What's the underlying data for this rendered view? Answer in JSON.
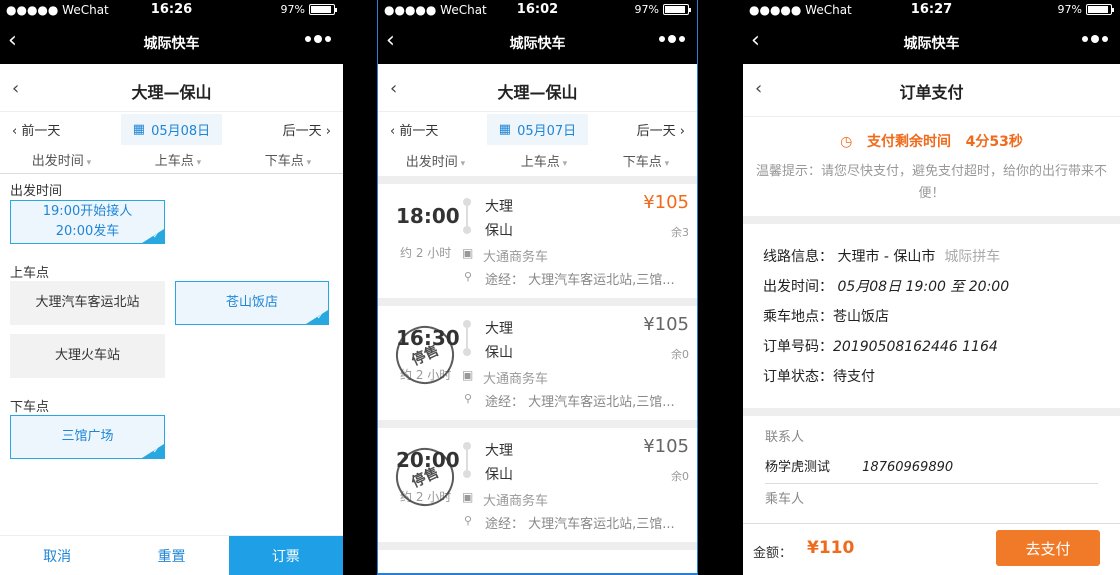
{
  "screens": [
    {
      "status": {
        "carrier": "●●●●● WeChat",
        "time": "16:26",
        "battery": "97%"
      },
      "nav_title": "城际快车",
      "page_title": "大理—保山",
      "prev_day": "前一天",
      "date": "05月08日",
      "next_day": "后一天",
      "filters": [
        "出发时间",
        "上车点",
        "下车点"
      ],
      "departure_label": "出发时间",
      "departure_option_line1": "19:00开始接人",
      "departure_option_line2": "20:00发车",
      "boarding_label": "上车点",
      "boarding_options": [
        "大理汽车客运北站",
        "苍山饭店",
        "大理火车站"
      ],
      "dropoff_label": "下车点",
      "dropoff_option": "三馆广场",
      "cancel": "取消",
      "reset": "重置",
      "book": "订票"
    },
    {
      "status": {
        "carrier": "●●●●● WeChat",
        "time": "16:02",
        "battery": "97%"
      },
      "nav_title": "城际快车",
      "page_title": "大理—保山",
      "prev_day": "前一天",
      "date": "05月07日",
      "next_day": "后一天",
      "filters": [
        "出发时间",
        "上车点",
        "下车点"
      ],
      "trips": [
        {
          "time": "18:00",
          "duration": "约 2 小时",
          "from": "大理",
          "to": "保山",
          "price": "¥105",
          "seats": "余3",
          "vehicle": "大通商务车",
          "via": "途经：  大理汽车客运北站,三馆..."
        },
        {
          "time": "16:30",
          "duration": "约 2 小时",
          "from": "大理",
          "to": "保山",
          "price": "¥105",
          "seats": "余0",
          "vehicle": "大通商务车",
          "via": "途经：  大理汽车客运北站,三馆...",
          "stamp": "停售"
        },
        {
          "time": "20:00",
          "duration": "约 2 小时",
          "from": "大理",
          "to": "保山",
          "price": "¥105",
          "seats": "余0",
          "vehicle": "大通商务车",
          "via": "途经：  大理汽车客运北站,三馆...",
          "stamp": "停售"
        }
      ]
    },
    {
      "status": {
        "carrier": "●●●●● WeChat",
        "time": "16:27",
        "battery": "97%"
      },
      "nav_title": "城际快车",
      "page_title": "订单支付",
      "timer_label": "支付剩余时间",
      "timer_value": "4分53秒",
      "tip": "温馨提示：请您尽快支付，避免支付超时，给你的出行带来不便！",
      "route_label": "线路信息：",
      "route_value": "大理市 - 保山市",
      "route_type": "城际拼车",
      "depart_label": "出发时间：",
      "depart_value": "05月08日 19:00 至 20:00",
      "pickup_label": "乘车地点：",
      "pickup_value": "苍山饭店",
      "order_label": "订单号码：",
      "order_value": "20190508162446 1164",
      "order_status_label": "订单状态：",
      "order_status_value": "待支付",
      "contact_label": "联系人",
      "contact_name": "杨学虎测试",
      "contact_phone": "18760969890",
      "passenger_label": "乘车人",
      "amount_label": "金额：",
      "amount_value": "¥110",
      "pay_button": "去支付"
    }
  ],
  "colors": {
    "accent_blue": "#1f86d6",
    "accent_orange": "#f06a1b",
    "primary_button": "#1fa0e6"
  }
}
